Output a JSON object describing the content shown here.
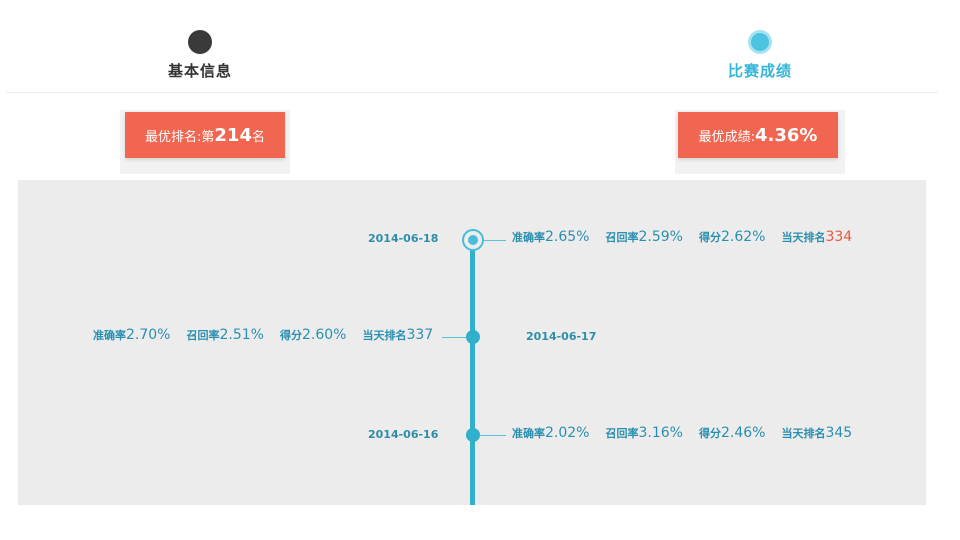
{
  "steps": [
    {
      "label": "基本信息",
      "state": "inactive"
    },
    {
      "label": "比赛成绩",
      "state": "active"
    }
  ],
  "summary": {
    "best_rank": {
      "prefix": "最优排名:第",
      "value": "214",
      "suffix": "名"
    },
    "best_score": {
      "prefix": "最优成绩:",
      "value": "4.36%"
    }
  },
  "timeline": [
    {
      "date": "2014-06-18",
      "side": "right",
      "current": true,
      "precision": {
        "label": "准确率",
        "value": "2.65%"
      },
      "recall": {
        "label": "召回率",
        "value": "2.59%"
      },
      "score": {
        "label": "得分",
        "value": "2.62%"
      },
      "rank": {
        "label": "当天排名",
        "value": "334",
        "highlight": true
      }
    },
    {
      "date": "2014-06-17",
      "side": "left",
      "current": false,
      "precision": {
        "label": "准确率",
        "value": "2.70%"
      },
      "recall": {
        "label": "召回率",
        "value": "2.51%"
      },
      "score": {
        "label": "得分",
        "value": "2.60%"
      },
      "rank": {
        "label": "当天排名",
        "value": "337",
        "highlight": false
      }
    },
    {
      "date": "2014-06-16",
      "side": "right",
      "current": false,
      "precision": {
        "label": "准确率",
        "value": "2.02%"
      },
      "recall": {
        "label": "召回率",
        "value": "3.16%"
      },
      "score": {
        "label": "得分",
        "value": "2.46%"
      },
      "rank": {
        "label": "当天排名",
        "value": "345",
        "highlight": false
      }
    }
  ],
  "colors": {
    "accent": "#31b0cc",
    "badge": "#f06650",
    "highlight": "#e8583e",
    "panel": "#ececec"
  }
}
